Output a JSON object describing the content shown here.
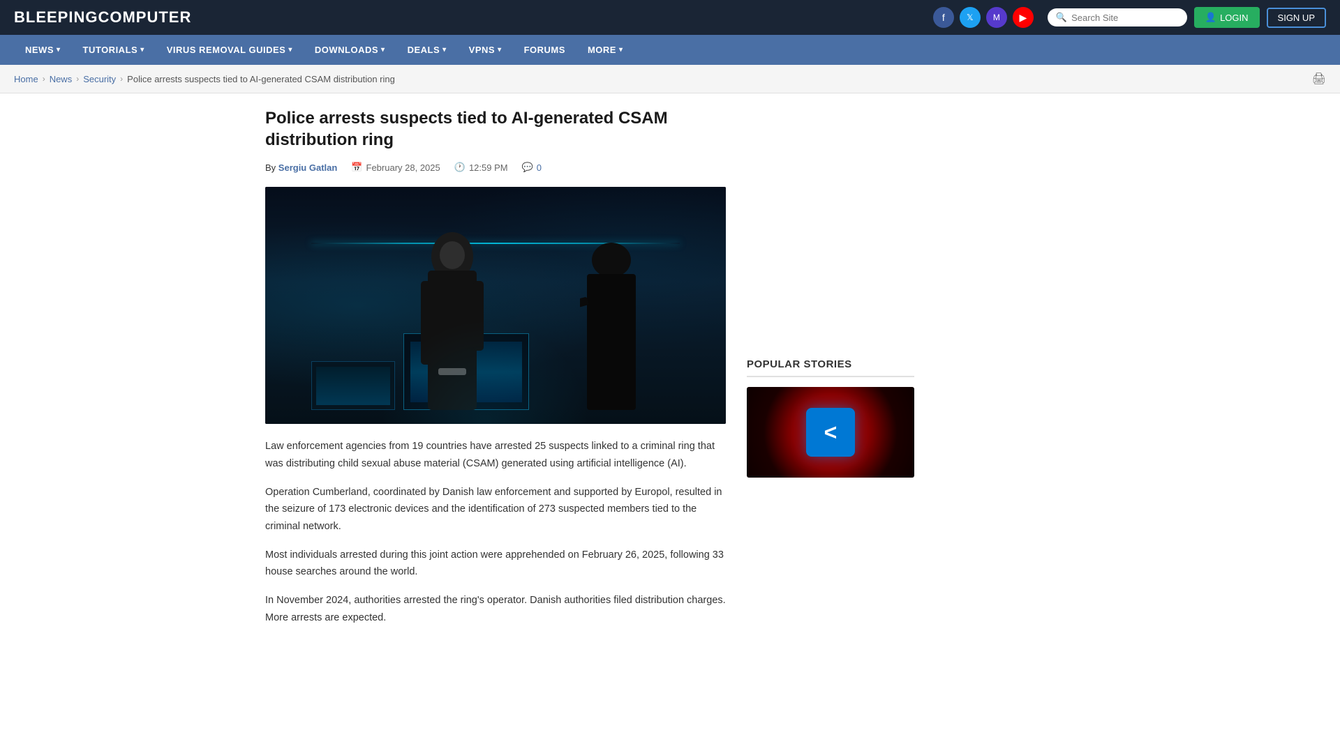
{
  "header": {
    "logo_prefix": "BLEEPING",
    "logo_suffix": "COMPUTER",
    "search_placeholder": "Search Site",
    "login_label": "LOGIN",
    "signup_label": "SIGN UP"
  },
  "social": [
    {
      "name": "facebook",
      "symbol": "f"
    },
    {
      "name": "twitter",
      "symbol": "𝕏"
    },
    {
      "name": "mastodon",
      "symbol": "M"
    },
    {
      "name": "youtube",
      "symbol": "▶"
    }
  ],
  "nav": {
    "items": [
      {
        "label": "NEWS",
        "has_dropdown": true
      },
      {
        "label": "TUTORIALS",
        "has_dropdown": true
      },
      {
        "label": "VIRUS REMOVAL GUIDES",
        "has_dropdown": true
      },
      {
        "label": "DOWNLOADS",
        "has_dropdown": true
      },
      {
        "label": "DEALS",
        "has_dropdown": true
      },
      {
        "label": "VPNS",
        "has_dropdown": true
      },
      {
        "label": "FORUMS",
        "has_dropdown": false
      },
      {
        "label": "MORE",
        "has_dropdown": true
      }
    ]
  },
  "breadcrumb": {
    "home": "Home",
    "news": "News",
    "security": "Security",
    "current": "Police arrests suspects tied to AI-generated CSAM distribution ring"
  },
  "article": {
    "title": "Police arrests suspects tied to AI-generated CSAM distribution ring",
    "author_prefix": "By",
    "author_name": "Sergiu Gatlan",
    "date": "February 28, 2025",
    "time": "12:59 PM",
    "comment_count": "0",
    "body_paragraphs": [
      "Law enforcement agencies from 19 countries have arrested 25 suspects linked to a criminal ring that was distributing child sexual abuse material (CSAM) generated using artificial intelligence (AI).",
      "Operation Cumberland, coordinated by Danish law enforcement and supported by Europol, resulted in the seizure of 173 electronic devices and the identification of 273 suspected members tied to the criminal network.",
      "Most individuals arrested during this joint action were apprehended on February 26, 2025, following 33 house searches around the world.",
      "In November 2024, authorities arrested the ring's operator. Danish authorities filed distribution charges. More arrests are expected."
    ]
  },
  "sidebar": {
    "popular_stories_label": "POPULAR STORIES"
  }
}
